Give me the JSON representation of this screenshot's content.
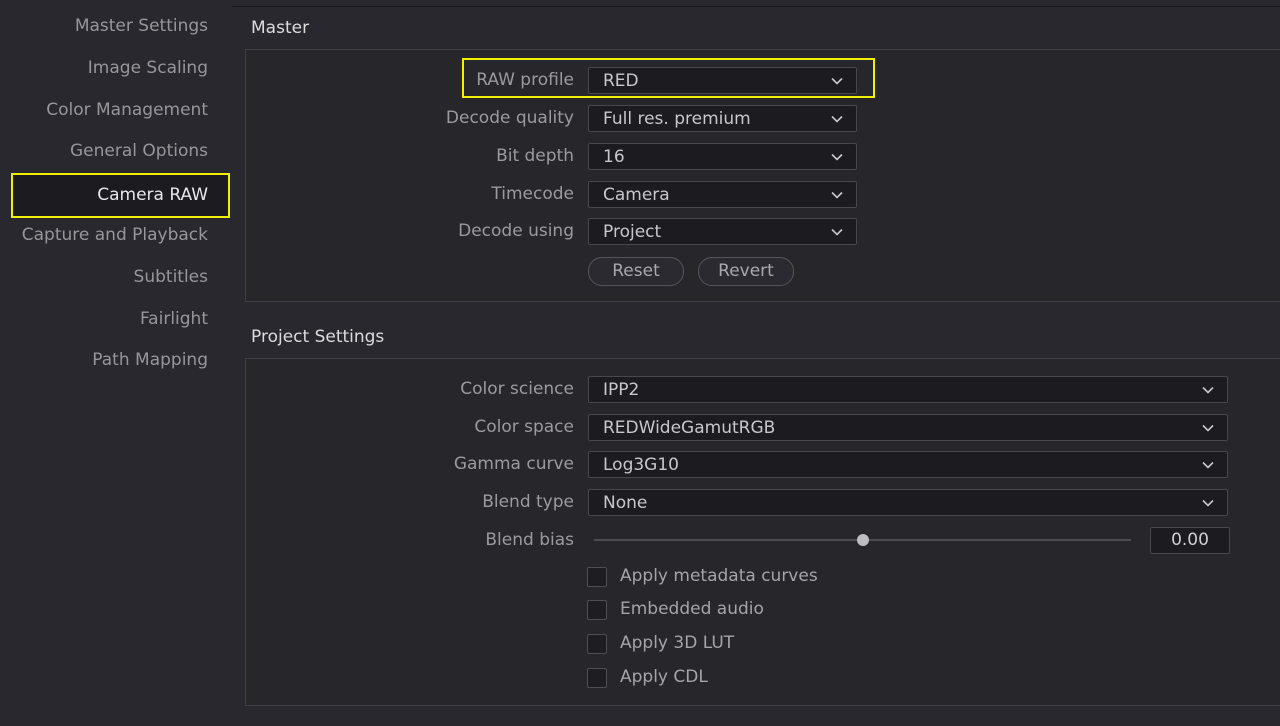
{
  "sidebar": {
    "items": [
      {
        "label": "Master Settings"
      },
      {
        "label": "Image Scaling"
      },
      {
        "label": "Color Management"
      },
      {
        "label": "General Options"
      },
      {
        "label": "Camera RAW"
      },
      {
        "label": "Capture and Playback"
      },
      {
        "label": "Subtitles"
      },
      {
        "label": "Fairlight"
      },
      {
        "label": "Path Mapping"
      }
    ],
    "active_index": 4
  },
  "master": {
    "title": "Master",
    "raw_profile": {
      "label": "RAW profile",
      "value": "RED"
    },
    "decode_quality": {
      "label": "Decode quality",
      "value": "Full res. premium"
    },
    "bit_depth": {
      "label": "Bit depth",
      "value": "16"
    },
    "timecode": {
      "label": "Timecode",
      "value": "Camera"
    },
    "decode_using": {
      "label": "Decode using",
      "value": "Project"
    },
    "reset_label": "Reset",
    "revert_label": "Revert"
  },
  "project": {
    "title": "Project Settings",
    "color_science": {
      "label": "Color science",
      "value": "IPP2"
    },
    "color_space": {
      "label": "Color space",
      "value": "REDWideGamutRGB"
    },
    "gamma_curve": {
      "label": "Gamma curve",
      "value": "Log3G10"
    },
    "blend_type": {
      "label": "Blend type",
      "value": "None"
    },
    "blend_bias": {
      "label": "Blend bias",
      "value": "0.00",
      "slider_fraction": 0.5
    },
    "checkboxes": [
      {
        "label": "Apply metadata curves",
        "checked": false
      },
      {
        "label": "Embedded audio",
        "checked": false
      },
      {
        "label": "Apply 3D LUT",
        "checked": false
      },
      {
        "label": "Apply CDL",
        "checked": false
      }
    ]
  },
  "colors": {
    "highlight": "#f0f000",
    "background": "#28282e",
    "field": "#1c1c20"
  },
  "icons": {
    "dropdown": "chevron-down-icon"
  }
}
